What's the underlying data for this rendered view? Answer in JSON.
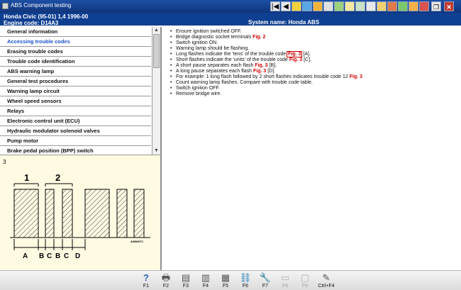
{
  "window": {
    "title": "ABS Component testing"
  },
  "header": {
    "vehicle": "Honda   Civic (95-01) 1,4   1996-00",
    "engine": "Engine code: D14A3",
    "system": "System name: Honda ABS"
  },
  "nav": {
    "first": "|◀",
    "prev": "◀"
  },
  "window_controls": {
    "restore": "❐",
    "close": "✕"
  },
  "sidebar": {
    "items": [
      {
        "label": "General information"
      },
      {
        "label": "Accessing trouble codes"
      },
      {
        "label": "Erasing trouble codes"
      },
      {
        "label": "Trouble code identification"
      },
      {
        "label": "ABS warning lamp"
      },
      {
        "label": "General test procedures"
      },
      {
        "label": "Warning lamp circuit"
      },
      {
        "label": "Wheel speed sensors"
      },
      {
        "label": "Relays"
      },
      {
        "label": "Electronic control unit (ECU)"
      },
      {
        "label": "Hydraulic modulator solenoid valves"
      },
      {
        "label": "Pump motor"
      },
      {
        "label": "Brake pedal position (BPP) switch"
      }
    ],
    "active_index": 1,
    "scroll_up": "▲",
    "scroll_down": "▼"
  },
  "steps": [
    {
      "text": "Ensure ignition switched OFF."
    },
    {
      "text": "Bridge diagnostic socket terminals ",
      "fig": "Fig. 2",
      "after": ""
    },
    {
      "text": "Switch ignition ON."
    },
    {
      "text": "Warning lamp should be flashing."
    },
    {
      "text": "Long flashes indicate the 'tens' of the trouble code ",
      "fig": "Fig. 3",
      "fig_highlight": true,
      "after": " [A]."
    },
    {
      "text": "Short flashes indicate the 'units' of the trouble code ",
      "fig": "Fig. 3",
      "after": " [C]."
    },
    {
      "text": "A short pause separates each flash ",
      "fig": "Fig. 3",
      "after": " [B]."
    },
    {
      "text": "A long pause separates each flash ",
      "fig": "Fig. 3",
      "after": " [D]."
    },
    {
      "text": "For example: 1 long flash followed by 2 short flashes indicates trouble code 12 ",
      "fig": "Fig. 3",
      "after": ""
    },
    {
      "text": "Count warning lamp flashes. Compare with trouble code table."
    },
    {
      "text": "Switch ignition OFF."
    },
    {
      "text": "Remove bridge wire."
    }
  ],
  "diagram": {
    "fig_number": "3",
    "group_labels": [
      "1",
      "2"
    ],
    "interval_labels": [
      "A",
      "B",
      "C",
      "B",
      "C",
      "D"
    ],
    "ref_code": "A08M0TC"
  },
  "footer": {
    "keys": [
      {
        "label": "F1",
        "icon": "help-icon",
        "glyph": "?",
        "enabled": true
      },
      {
        "label": "F2",
        "icon": "print-icon",
        "glyph": "🖶",
        "enabled": true
      },
      {
        "label": "F3",
        "icon": "copy-pages-icon",
        "glyph": "▤",
        "enabled": true
      },
      {
        "label": "F4",
        "icon": "multi-page-icon",
        "glyph": "▥",
        "enabled": true
      },
      {
        "label": "F5",
        "icon": "calculator-icon",
        "glyph": "▦",
        "enabled": true
      },
      {
        "label": "F6",
        "icon": "component-icon",
        "glyph": "⛓",
        "enabled": true
      },
      {
        "label": "F7",
        "icon": "tools-icon",
        "glyph": "🔧",
        "enabled": true
      },
      {
        "label": "F8",
        "icon": "edit-disabled-icon",
        "glyph": "▭",
        "enabled": false
      },
      {
        "label": "F9",
        "icon": "clipboard-disabled-icon",
        "glyph": "▢",
        "enabled": false
      },
      {
        "label": "Ctrl+F4",
        "icon": "notes-icon",
        "glyph": "✎",
        "enabled": true
      }
    ]
  },
  "colors": {
    "title_bar": "#1c4fa6",
    "header_bar": "#0f3f91",
    "active_menu": "#1b50c9",
    "figure_link": "#d00000",
    "diagram_bg": "#fffbe3"
  }
}
